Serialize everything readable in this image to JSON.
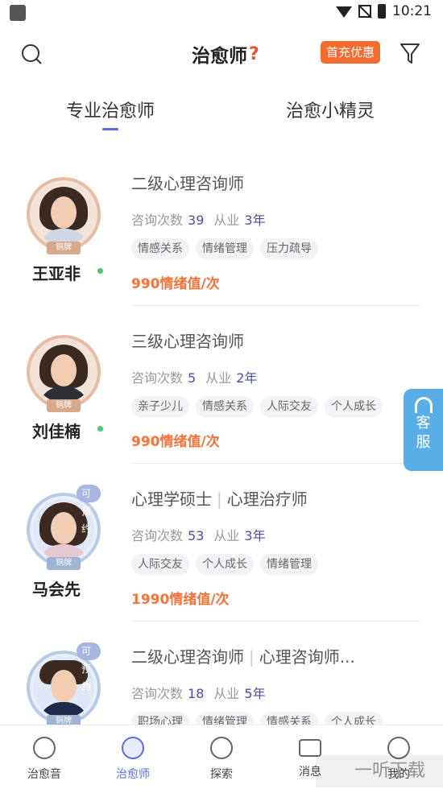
{
  "status_bar": {
    "time": "10:21"
  },
  "header": {
    "title": "治愈师",
    "help_glyph": "?",
    "promo_label": "首充优惠",
    "icons": {
      "search": "search-icon",
      "filter": "filter-icon"
    }
  },
  "tabs": [
    {
      "label": "专业治愈师",
      "active": true
    },
    {
      "label": "治愈小精灵",
      "active": false
    }
  ],
  "counselors": [
    {
      "name": "王亚非",
      "online": true,
      "tier": "铜牌",
      "available": "",
      "title_parts": [
        "二级心理咨询师"
      ],
      "consult_label": "咨询次数",
      "consult_count": "39",
      "exp_label": "从业",
      "exp_years": "3年",
      "tags": [
        "情感关系",
        "情绪管理",
        "压力疏导"
      ],
      "price": "990情绪值/次"
    },
    {
      "name": "刘佳楠",
      "online": true,
      "tier": "铜牌",
      "available": "",
      "title_parts": [
        "三级心理咨询师"
      ],
      "consult_label": "咨询次数",
      "consult_count": "5",
      "exp_label": "从业",
      "exp_years": "2年",
      "tags": [
        "亲子少儿",
        "情感关系",
        "人际交友",
        "个人成长"
      ],
      "price": "990情绪值/次"
    },
    {
      "name": "马会先",
      "online": false,
      "tier": "铜牌",
      "available": "可预约",
      "title_parts": [
        "心理学硕士",
        "心理治疗师"
      ],
      "consult_label": "咨询次数",
      "consult_count": "53",
      "exp_label": "从业",
      "exp_years": "3年",
      "tags": [
        "人际交友",
        "个人成长",
        "情绪管理"
      ],
      "price": "1990情绪值/次"
    },
    {
      "name": "",
      "online": false,
      "tier": "铜牌",
      "available": "可预约",
      "title_parts": [
        "二级心理咨询师",
        "心理咨询师..."
      ],
      "consult_label": "咨询次数",
      "consult_count": "18",
      "exp_label": "从业",
      "exp_years": "5年",
      "tags": [
        "职场心理",
        "情绪管理",
        "情感关系",
        "个人成长"
      ],
      "price": ""
    }
  ],
  "customer_service": {
    "label_1": "客",
    "label_2": "服"
  },
  "bottom_nav": [
    {
      "label": "治愈音",
      "icon": "music-disc-icon",
      "active": false
    },
    {
      "label": "治愈师",
      "icon": "counselor-icon",
      "active": true
    },
    {
      "label": "探索",
      "icon": "compass-icon",
      "active": false
    },
    {
      "label": "消息",
      "icon": "mail-icon",
      "active": false
    },
    {
      "label": "我的",
      "icon": "smile-face-icon",
      "active": false
    }
  ],
  "watermark": "一听下载",
  "colors": {
    "accent": "#5b6ee1",
    "price": "#f4733a",
    "promo": "#f46b2f",
    "service": "#5aaee8"
  }
}
